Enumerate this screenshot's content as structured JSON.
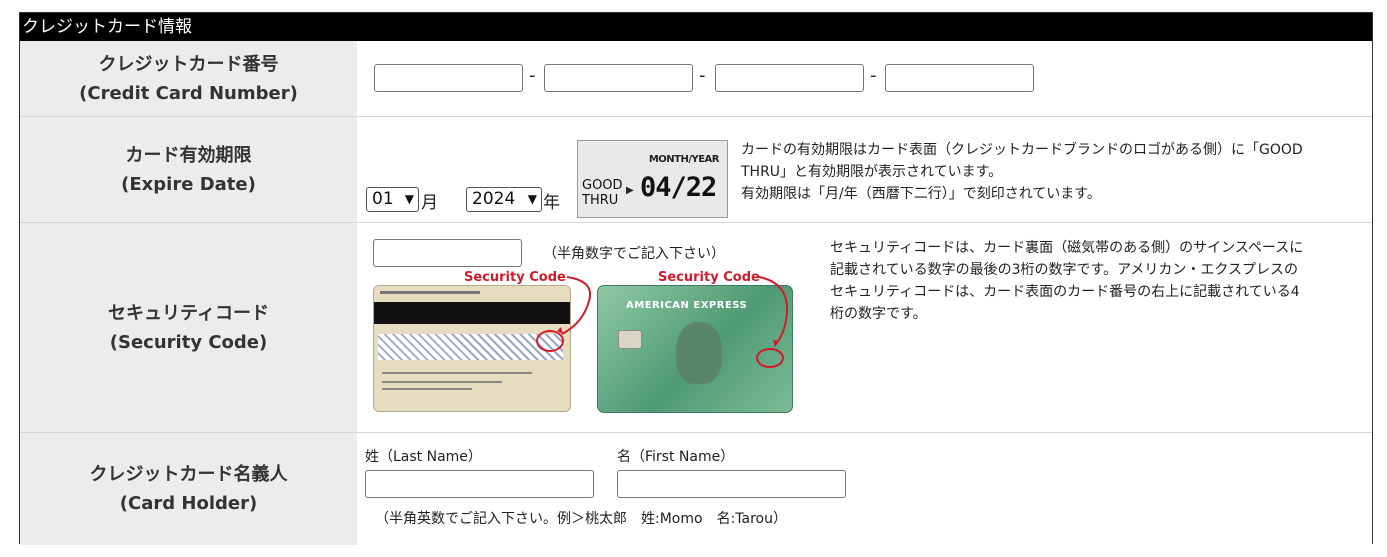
{
  "section": {
    "title": "クレジットカード情報"
  },
  "rows": {
    "card_number": {
      "label_jp": "クレジットカード番号",
      "label_en": "(Credit Card Number)",
      "fields": [
        "",
        "",
        "",
        ""
      ],
      "separator": "-"
    },
    "expire": {
      "label_jp": "カード有効期限",
      "label_en": "(Expire Date)",
      "month_value": "01",
      "month_unit": "月",
      "year_value": "2024",
      "year_unit": "年",
      "sample": {
        "top": "MONTH/YEAR",
        "good": "GOOD",
        "thru": "THRU",
        "date": "04/22"
      },
      "desc_line1": "カードの有効期限はカード表面（クレジットカードブランドのロゴがある側）に「GOOD",
      "desc_line2": "THRU」と有効期限が表示されています。",
      "desc_line3": "有効期限は「月/年（西暦下二行）」で刻印されています。"
    },
    "security": {
      "label_jp": "セキュリティコード",
      "label_en": "(Security Code)",
      "value": "",
      "hint": "（半角数字でご記入下さい）",
      "callout_label": "Security Code",
      "card_brand": "AMERICAN EXPRESS",
      "desc_line1": "セキュリティコードは、カード裏面（磁気帯のある側）のサインスペースに",
      "desc_line2": "記載されている数字の最後の3桁の数字です。アメリカン・エクスプレスの",
      "desc_line3": "セキュリティコードは、カード表面のカード番号の右上に記載されている4",
      "desc_line4": "桁の数字です。"
    },
    "holder": {
      "label_jp": "クレジットカード名義人",
      "label_en": "(Card Holder)",
      "last_name_label": "姓（Last Name）",
      "first_name_label": "名（First Name）",
      "last_name_value": "",
      "first_name_value": "",
      "hint": "（半角英数でご記入下さい。例＞桃太郎　姓:Momo　名:Tarou）"
    }
  },
  "colors": {
    "header_bg": "#000000",
    "label_bg": "#ececec",
    "callout_red": "#d11b2a"
  }
}
